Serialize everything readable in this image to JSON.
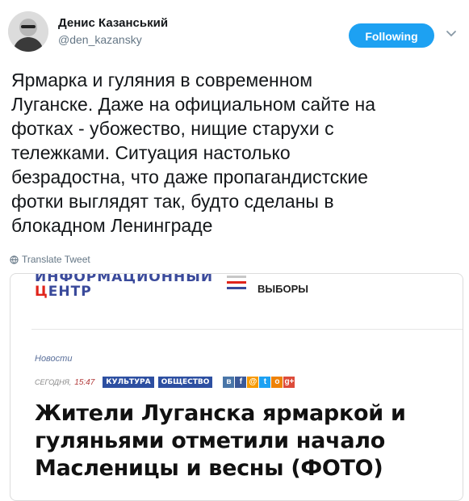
{
  "user": {
    "name": "Денис Казанський",
    "handle": "@den_kazansky"
  },
  "follow_button": {
    "label": "Following"
  },
  "tweet": {
    "text": "Ярмарка и гуляния в современном\nЛуганске. Даже на официальном сайте на\nфотках - убожество, нищие старухи с\nтележками. Ситуация настолько\nбезрадостна, что даже пропагандистские\nфотки выглядят так, будто сделаны в\nблокадном Ленинграде",
    "translate_label": "Translate Tweet"
  },
  "card": {
    "logo_top": "ИНФОРМАЦИОННЫЙ",
    "logo_bottom_first": "Ц",
    "logo_bottom_rest": "ЕНТР",
    "nav_label": "ВЫБОРЫ",
    "category": "Новости",
    "date_label": "сегодня,",
    "time": "15:47",
    "tags": [
      "КУЛЬТУРА",
      "ОБЩЕСТВО"
    ],
    "share_icons": [
      "vk-icon",
      "facebook-icon",
      "mail-icon",
      "twitter-icon",
      "odnoklassniki-icon",
      "google-plus-icon"
    ],
    "article_title": "Жители Луганска ярмаркой и гуляньями отметили начало Масленицы и весны (ФОТО)"
  },
  "colors": {
    "follow_button": "#1da1f2",
    "handle": "#657786",
    "logo_blue": "#3a4a9b",
    "logo_red": "#e0241b",
    "tag_blue": "#2d4fa1"
  }
}
